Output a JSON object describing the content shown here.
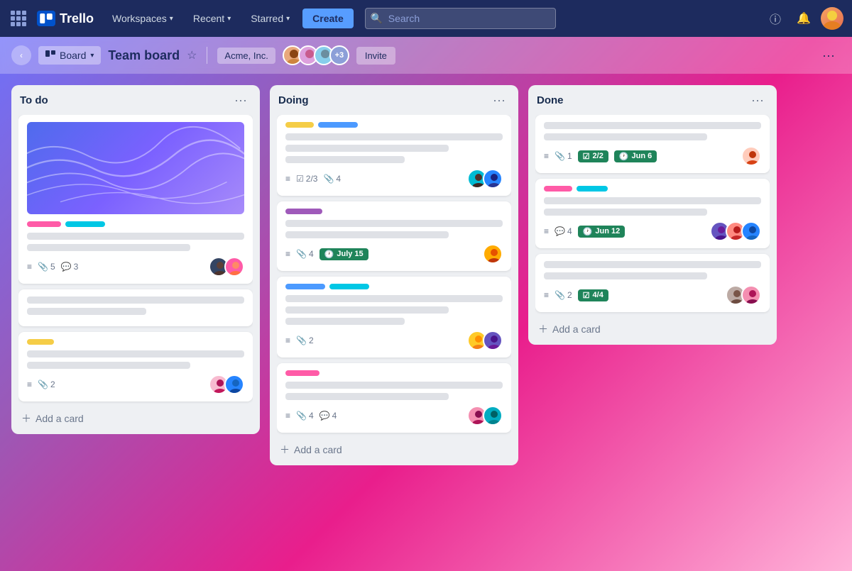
{
  "app": {
    "name": "Trello"
  },
  "navbar": {
    "workspaces_label": "Workspaces",
    "recent_label": "Recent",
    "starred_label": "Starred",
    "create_label": "Create",
    "search_placeholder": "Search",
    "info_icon": "ℹ",
    "bell_icon": "🔔"
  },
  "board_bar": {
    "view_label": "Board",
    "title": "Team board",
    "workspace_name": "Acme, Inc.",
    "member_count": "+3",
    "invite_label": "Invite"
  },
  "columns": [
    {
      "id": "todo",
      "title": "To do",
      "cards": [
        {
          "id": "todo-1",
          "has_cover": true,
          "tags": [
            "pink",
            "cyan"
          ],
          "lines": [
            "full",
            "medium"
          ],
          "meta": {
            "icon": "≡",
            "attach": "5",
            "comment": "3"
          },
          "avatars": [
            "dark-female",
            "female-2"
          ]
        },
        {
          "id": "todo-2",
          "has_cover": false,
          "tags": [],
          "lines": [
            "full",
            "short"
          ],
          "meta": {},
          "avatars": []
        },
        {
          "id": "todo-3",
          "has_cover": false,
          "tags": [
            "yellow"
          ],
          "lines": [
            "full",
            "medium"
          ],
          "meta": {
            "icon": "≡",
            "attach": "2"
          },
          "avatars": [
            "pink-female",
            "blue-male"
          ]
        }
      ],
      "add_label": "Add a card"
    },
    {
      "id": "doing",
      "title": "Doing",
      "cards": [
        {
          "id": "doing-1",
          "has_cover": false,
          "tags": [
            "yellow-sm",
            "blue-sm"
          ],
          "lines": [
            "full",
            "medium",
            "short"
          ],
          "meta": {
            "icon": "≡",
            "attach": "2/3",
            "attach2": "4",
            "is_checklist": true
          },
          "avatars": [
            "dark-female2",
            "blue-male2"
          ]
        },
        {
          "id": "doing-2",
          "has_cover": false,
          "tags": [
            "purple"
          ],
          "lines": [
            "full",
            "medium"
          ],
          "meta": {
            "icon": "≡",
            "attach": "4",
            "clock": "July 15"
          },
          "avatars": [
            "yellow-male"
          ]
        },
        {
          "id": "doing-3",
          "has_cover": false,
          "tags": [
            "blue",
            "teal"
          ],
          "lines": [
            "full",
            "medium",
            "short"
          ],
          "meta": {
            "icon": "≡",
            "attach": "2"
          },
          "avatars": [
            "yellow-female2",
            "purple-male"
          ]
        },
        {
          "id": "doing-4",
          "has_cover": false,
          "tags": [
            "pink-sm"
          ],
          "lines": [
            "full",
            "medium"
          ],
          "meta": {
            "icon": "≡",
            "attach": "4",
            "comment": "4"
          },
          "avatars": [
            "pink-female2",
            "teal-male"
          ]
        }
      ],
      "add_label": "Add a card"
    },
    {
      "id": "done",
      "title": "Done",
      "cards": [
        {
          "id": "done-1",
          "has_cover": false,
          "tags": [],
          "lines": [
            "full",
            "medium"
          ],
          "meta": {
            "icon": "≡",
            "attach": "1",
            "checklist": "2/2",
            "clock": "Jun 6"
          },
          "avatars": [
            "light-female"
          ]
        },
        {
          "id": "done-2",
          "has_cover": false,
          "tags": [
            "pink-sm",
            "teal-sm"
          ],
          "lines": [
            "full",
            "medium"
          ],
          "meta": {
            "icon": "≡",
            "comment": "4",
            "clock": "Jun 12"
          },
          "avatars": [
            "purple-female",
            "orange-female",
            "blue-male3"
          ]
        },
        {
          "id": "done-3",
          "has_cover": false,
          "tags": [],
          "lines": [
            "full",
            "medium"
          ],
          "meta": {
            "icon": "≡",
            "attach": "2",
            "checklist": "4/4"
          },
          "avatars": [
            "brown-female",
            "pink-female3"
          ]
        }
      ],
      "add_label": "Add a card"
    }
  ]
}
